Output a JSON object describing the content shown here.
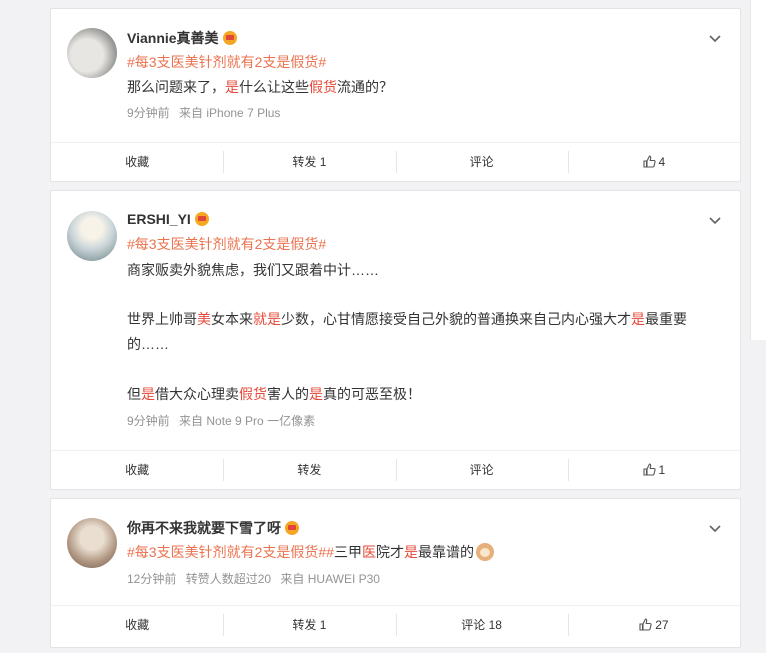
{
  "posts": [
    {
      "username": "Viannie真善美",
      "tag": "#每3支医美针剂就有2支是假货#",
      "time": "9分钟前",
      "from": "来自 iPhone 7 Plus",
      "actions": {
        "fav": "收藏",
        "repost": "转发 1",
        "comment": "评论",
        "like": "4"
      }
    },
    {
      "username": "ERSHI_YI",
      "tag": "#每3支医美针剂就有2支是假货#",
      "time": "9分钟前",
      "from": "来自 Note 9 Pro 一亿像素",
      "actions": {
        "fav": "收藏",
        "repost": "转发",
        "comment": "评论",
        "like": "1"
      }
    },
    {
      "username": "你再不来我就要下雪了呀",
      "tag": "#每3支医美针剂就有2支是假货#",
      "tag2": "#三甲医院才是最靠谱的",
      "time": "12分钟前",
      "reposters": "转赞人数超过20",
      "from": "来自 HUAWEI P30",
      "actions": {
        "fav": "收藏",
        "repost": "转发 1",
        "comment": "评论 18",
        "like": "27"
      }
    }
  ],
  "colors": {
    "topic": "#eb7350",
    "highlight": "#e64a3a",
    "meta": "#939393"
  },
  "icons": {
    "expand": "chevron-down-icon",
    "like": "thumbs-up-icon",
    "badge": "crown-badge-icon"
  }
}
